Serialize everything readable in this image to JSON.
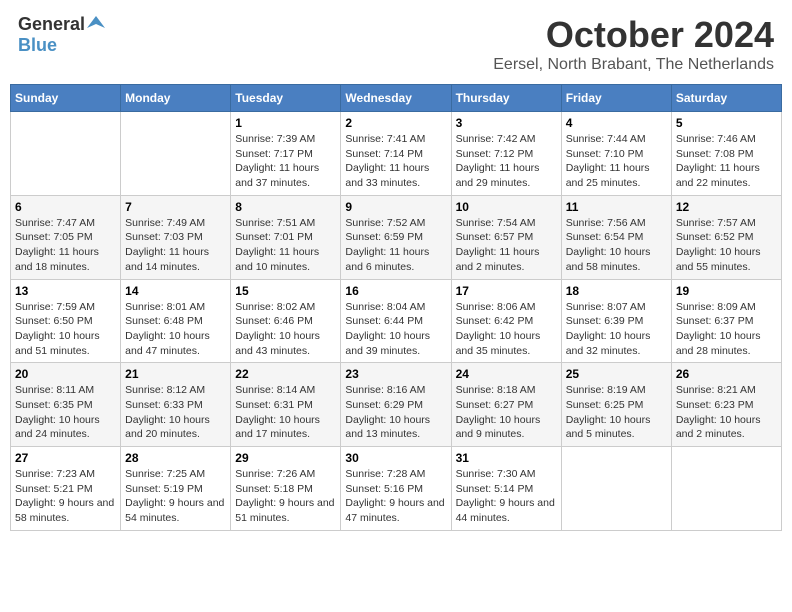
{
  "header": {
    "logo_general": "General",
    "logo_blue": "Blue",
    "month_title": "October 2024",
    "location": "Eersel, North Brabant, The Netherlands"
  },
  "weekdays": [
    "Sunday",
    "Monday",
    "Tuesday",
    "Wednesday",
    "Thursday",
    "Friday",
    "Saturday"
  ],
  "weeks": [
    [
      {
        "day": "",
        "info": ""
      },
      {
        "day": "",
        "info": ""
      },
      {
        "day": "1",
        "info": "Sunrise: 7:39 AM\nSunset: 7:17 PM\nDaylight: 11 hours and 37 minutes."
      },
      {
        "day": "2",
        "info": "Sunrise: 7:41 AM\nSunset: 7:14 PM\nDaylight: 11 hours and 33 minutes."
      },
      {
        "day": "3",
        "info": "Sunrise: 7:42 AM\nSunset: 7:12 PM\nDaylight: 11 hours and 29 minutes."
      },
      {
        "day": "4",
        "info": "Sunrise: 7:44 AM\nSunset: 7:10 PM\nDaylight: 11 hours and 25 minutes."
      },
      {
        "day": "5",
        "info": "Sunrise: 7:46 AM\nSunset: 7:08 PM\nDaylight: 11 hours and 22 minutes."
      }
    ],
    [
      {
        "day": "6",
        "info": "Sunrise: 7:47 AM\nSunset: 7:05 PM\nDaylight: 11 hours and 18 minutes."
      },
      {
        "day": "7",
        "info": "Sunrise: 7:49 AM\nSunset: 7:03 PM\nDaylight: 11 hours and 14 minutes."
      },
      {
        "day": "8",
        "info": "Sunrise: 7:51 AM\nSunset: 7:01 PM\nDaylight: 11 hours and 10 minutes."
      },
      {
        "day": "9",
        "info": "Sunrise: 7:52 AM\nSunset: 6:59 PM\nDaylight: 11 hours and 6 minutes."
      },
      {
        "day": "10",
        "info": "Sunrise: 7:54 AM\nSunset: 6:57 PM\nDaylight: 11 hours and 2 minutes."
      },
      {
        "day": "11",
        "info": "Sunrise: 7:56 AM\nSunset: 6:54 PM\nDaylight: 10 hours and 58 minutes."
      },
      {
        "day": "12",
        "info": "Sunrise: 7:57 AM\nSunset: 6:52 PM\nDaylight: 10 hours and 55 minutes."
      }
    ],
    [
      {
        "day": "13",
        "info": "Sunrise: 7:59 AM\nSunset: 6:50 PM\nDaylight: 10 hours and 51 minutes."
      },
      {
        "day": "14",
        "info": "Sunrise: 8:01 AM\nSunset: 6:48 PM\nDaylight: 10 hours and 47 minutes."
      },
      {
        "day": "15",
        "info": "Sunrise: 8:02 AM\nSunset: 6:46 PM\nDaylight: 10 hours and 43 minutes."
      },
      {
        "day": "16",
        "info": "Sunrise: 8:04 AM\nSunset: 6:44 PM\nDaylight: 10 hours and 39 minutes."
      },
      {
        "day": "17",
        "info": "Sunrise: 8:06 AM\nSunset: 6:42 PM\nDaylight: 10 hours and 35 minutes."
      },
      {
        "day": "18",
        "info": "Sunrise: 8:07 AM\nSunset: 6:39 PM\nDaylight: 10 hours and 32 minutes."
      },
      {
        "day": "19",
        "info": "Sunrise: 8:09 AM\nSunset: 6:37 PM\nDaylight: 10 hours and 28 minutes."
      }
    ],
    [
      {
        "day": "20",
        "info": "Sunrise: 8:11 AM\nSunset: 6:35 PM\nDaylight: 10 hours and 24 minutes."
      },
      {
        "day": "21",
        "info": "Sunrise: 8:12 AM\nSunset: 6:33 PM\nDaylight: 10 hours and 20 minutes."
      },
      {
        "day": "22",
        "info": "Sunrise: 8:14 AM\nSunset: 6:31 PM\nDaylight: 10 hours and 17 minutes."
      },
      {
        "day": "23",
        "info": "Sunrise: 8:16 AM\nSunset: 6:29 PM\nDaylight: 10 hours and 13 minutes."
      },
      {
        "day": "24",
        "info": "Sunrise: 8:18 AM\nSunset: 6:27 PM\nDaylight: 10 hours and 9 minutes."
      },
      {
        "day": "25",
        "info": "Sunrise: 8:19 AM\nSunset: 6:25 PM\nDaylight: 10 hours and 5 minutes."
      },
      {
        "day": "26",
        "info": "Sunrise: 8:21 AM\nSunset: 6:23 PM\nDaylight: 10 hours and 2 minutes."
      }
    ],
    [
      {
        "day": "27",
        "info": "Sunrise: 7:23 AM\nSunset: 5:21 PM\nDaylight: 9 hours and 58 minutes."
      },
      {
        "day": "28",
        "info": "Sunrise: 7:25 AM\nSunset: 5:19 PM\nDaylight: 9 hours and 54 minutes."
      },
      {
        "day": "29",
        "info": "Sunrise: 7:26 AM\nSunset: 5:18 PM\nDaylight: 9 hours and 51 minutes."
      },
      {
        "day": "30",
        "info": "Sunrise: 7:28 AM\nSunset: 5:16 PM\nDaylight: 9 hours and 47 minutes."
      },
      {
        "day": "31",
        "info": "Sunrise: 7:30 AM\nSunset: 5:14 PM\nDaylight: 9 hours and 44 minutes."
      },
      {
        "day": "",
        "info": ""
      },
      {
        "day": "",
        "info": ""
      }
    ]
  ]
}
